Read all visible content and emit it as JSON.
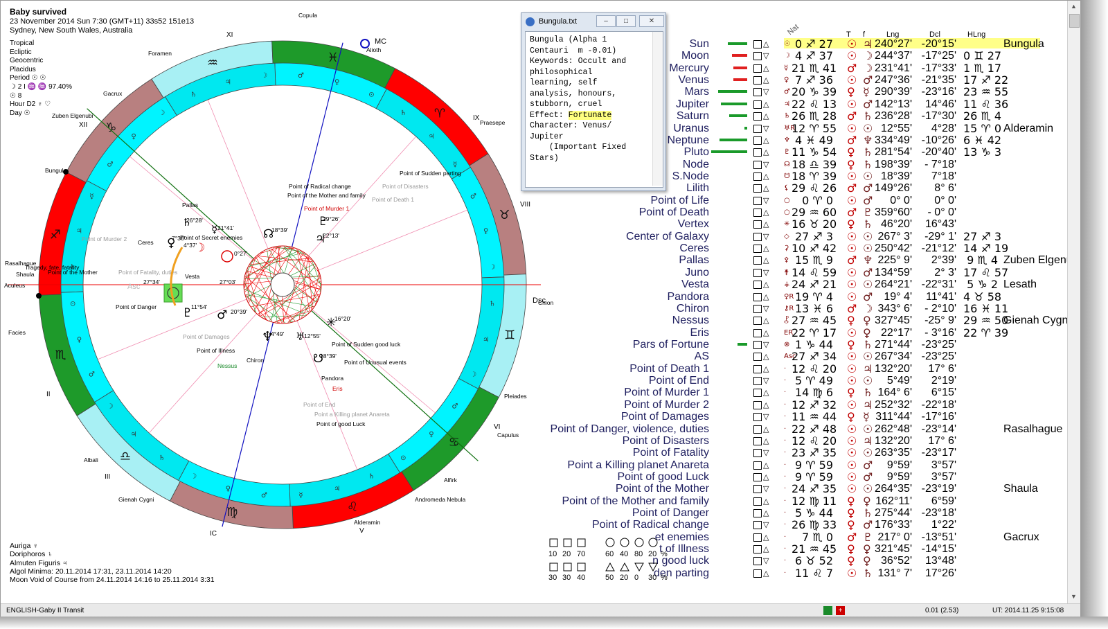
{
  "header": {
    "title": "Baby survived",
    "date_line": "23 November 2014  Sun   7:30 (GMT+11) 33s52  151e13",
    "place": "Sydney, New South Wales, Australia"
  },
  "settings": {
    "lines": [
      "Tropical",
      "Ecliptic",
      "Geocentric",
      "Placidus",
      "Period ☉ ☉",
      "☽  2 I  ♒ ♒ 97.40%",
      "☉  8",
      "Hour D2 ♀ ♡",
      "Day ☉"
    ]
  },
  "bottom_info": [
    "Auriga  ♀",
    "Doriphoros  ♄",
    "Almuten Figuris  ♃",
    "Algol Minima: 20.11.2014 17:31,  23.11.2014 14:20",
    "Moon Void of Course from 24.11.2014 14:16 to 25.11.2014  3:31"
  ],
  "status": {
    "left": "ENGLISH-Gaby  II Transit",
    "mid": "0.01 (2.53)",
    "right": "UT: 2014.11.25  9:15:08"
  },
  "popup": {
    "title": "Bungula.txt",
    "line1": "Bungula (Alpha 1\nCentauri  m -0.01)\nKeywords: Occult and\nphilosophical\nlearning, self\nanalysis, honours,\nstubborn, cruel\nEffect: ",
    "effect": "Fortunate",
    "line2": "\nCharacter: Venus/\nJupiter\n    (Important Fixed\nStars)",
    "btn_min": "–",
    "btn_max": "□",
    "btn_close": "✕"
  },
  "table_headers": {
    "nat": "Nat",
    "t": "T",
    "f": "f",
    "lng": "Lng",
    "dcl": "Dcl",
    "hlng": "HLng"
  },
  "table_rows": [
    {
      "name": "Sun",
      "sym": "☉",
      "pos": "0 ♐ 27",
      "t": "☉",
      "f": "♃",
      "lng": "240°27'",
      "dcl": "-20°15'",
      "hlng": "",
      "star": "Bungula"
    },
    {
      "name": "Moon",
      "sym": "☽",
      "pos": "4 ♐ 37",
      "t": "☉",
      "f": "☽",
      "lng": "244°37'",
      "dcl": "-17°25'",
      "hlng": "0 ♊ 27",
      "star": ""
    },
    {
      "name": "Mercury",
      "sym": "☿",
      "pos": "21 ♏ 41",
      "t": "♂",
      "f": "☽",
      "lng": "231°41'",
      "dcl": "-17°33'",
      "hlng": "1 ♏ 17",
      "star": ""
    },
    {
      "name": "Venus",
      "sym": "♀",
      "pos": "7 ♐ 36",
      "t": "☉",
      "f": "♂",
      "lng": "247°36'",
      "dcl": "-21°35'",
      "hlng": "17 ♐ 22",
      "star": ""
    },
    {
      "name": "Mars",
      "sym": "♂",
      "pos": "20 ♑ 39",
      "t": "♀",
      "f": "☿",
      "lng": "290°39'",
      "dcl": "-23°16'",
      "hlng": "23 ♒ 55",
      "star": ""
    },
    {
      "name": "Jupiter",
      "sym": "♃",
      "pos": "22 ♌ 13",
      "t": "☉",
      "f": "♂",
      "lng": "142°13'",
      "dcl": "14°46'",
      "hlng": "11 ♌ 36",
      "star": ""
    },
    {
      "name": "Saturn",
      "sym": "♄",
      "pos": "26 ♏ 28",
      "t": "♂",
      "f": "♄",
      "lng": "236°28'",
      "dcl": "-17°30'",
      "hlng": "26 ♏  4",
      "star": ""
    },
    {
      "name": "Uranus",
      "sym": "♅R",
      "pos": "12 ♈ 55",
      "t": "☉",
      "f": "☉",
      "lng": "12°55'",
      "dcl": "4°28'",
      "hlng": "15 ♈  0",
      "star": "Alderamin"
    },
    {
      "name": "Neptune",
      "sym": "♆",
      "pos": "4 ♓ 49",
      "t": "♂",
      "f": "♆",
      "lng": "334°49'",
      "dcl": "-10°26'",
      "hlng": "6 ♓ 42",
      "star": ""
    },
    {
      "name": "Pluto",
      "sym": "♇",
      "pos": "11 ♑ 54",
      "t": "♀",
      "f": "♄",
      "lng": "281°54'",
      "dcl": "-20°40'",
      "hlng": "13 ♑  3",
      "star": ""
    },
    {
      "name": "Node",
      "sym": "☊",
      "pos": "18 ♎ 39",
      "t": "♀",
      "f": "♄",
      "lng": "198°39'",
      "dcl": "- 7°18'",
      "hlng": "",
      "star": ""
    },
    {
      "name": "S.Node",
      "sym": "☋",
      "pos": "18 ♈ 39",
      "t": "☉",
      "f": "☉",
      "lng": "18°39'",
      "dcl": "7°18'",
      "hlng": "",
      "star": ""
    },
    {
      "name": "Lilith",
      "sym": "⚸",
      "pos": "29 ♌ 26",
      "t": "♂",
      "f": "♂",
      "lng": "149°26'",
      "dcl": "8° 6'",
      "hlng": "",
      "star": ""
    },
    {
      "name": "Point of Life",
      "sym": "○",
      "pos": "0 ♈  0",
      "t": "☉",
      "f": "♂",
      "lng": "0° 0'",
      "dcl": "0° 0'",
      "hlng": "",
      "star": ""
    },
    {
      "name": "Point of Death",
      "sym": "○",
      "pos": "29 ♒ 60",
      "t": "♂",
      "f": "♇",
      "lng": "359°60'",
      "dcl": "- 0° 0'",
      "hlng": "",
      "star": ""
    },
    {
      "name": "Vertex",
      "sym": "✳",
      "pos": "16 ♉ 20",
      "t": "♀",
      "f": "♄",
      "lng": "46°20'",
      "dcl": "16°43'",
      "hlng": "",
      "star": ""
    },
    {
      "name": "Center of Galaxy",
      "sym": "◇",
      "pos": "27 ♐  3",
      "t": "☉",
      "f": "☉",
      "lng": "267° 3'",
      "dcl": "-29° 1'",
      "hlng": "27 ♐  3",
      "star": ""
    },
    {
      "name": "Ceres",
      "sym": "⚳",
      "pos": "10 ♐ 42",
      "t": "☉",
      "f": "☉",
      "lng": "250°42'",
      "dcl": "-21°12'",
      "hlng": "14 ♐ 19",
      "star": ""
    },
    {
      "name": "Pallas",
      "sym": "⚴",
      "pos": "15 ♏  9",
      "t": "♂",
      "f": "♆",
      "lng": "225° 9'",
      "dcl": "2°39'",
      "hlng": "9 ♏  4",
      "star": "Zuben Elgenubi"
    },
    {
      "name": "Juno",
      "sym": "⚵",
      "pos": "14 ♌ 59",
      "t": "☉",
      "f": "♂",
      "lng": "134°59'",
      "dcl": "2° 3'",
      "hlng": "17 ♌ 57",
      "star": ""
    },
    {
      "name": "Vesta",
      "sym": "⚶",
      "pos": "24 ♐ 21",
      "t": "☉",
      "f": "☉",
      "lng": "264°21'",
      "dcl": "-22°31'",
      "hlng": "5 ♑  2",
      "star": "Lesath"
    },
    {
      "name": "Pandora",
      "sym": "♀R",
      "pos": "19 ♈  4",
      "t": "☉",
      "f": "♂",
      "lng": "19° 4'",
      "dcl": "11°41'",
      "hlng": "4 ♉ 58",
      "star": ""
    },
    {
      "name": "Chiron",
      "sym": "⚷R",
      "pos": "13 ♓  6",
      "t": "♂",
      "f": "☽",
      "lng": "343° 6'",
      "dcl": "- 2°10'",
      "hlng": "16 ♓ 11",
      "star": ""
    },
    {
      "name": "Nessus",
      "sym": "⯛",
      "pos": "27 ♒ 45",
      "t": "♀",
      "f": "♀",
      "lng": "327°45'",
      "dcl": "-25° 9'",
      "hlng": "29 ♒ 50",
      "star": "Gienah Cygni"
    },
    {
      "name": "Eris",
      "sym": "ER",
      "pos": "22 ♈ 17",
      "t": "☉",
      "f": "♀",
      "lng": "22°17'",
      "dcl": "- 3°16'",
      "hlng": "22 ♈ 39",
      "star": ""
    },
    {
      "name": "Pars of Fortune",
      "sym": "⊗",
      "pos": "1 ♑ 44",
      "t": "♀",
      "f": "♄",
      "lng": "271°44'",
      "dcl": "-23°25'",
      "hlng": "",
      "star": ""
    },
    {
      "name": "AS",
      "sym": "Asc",
      "pos": "27 ♐ 34",
      "t": "☉",
      "f": "☉",
      "lng": "267°34'",
      "dcl": "-23°25'",
      "hlng": "",
      "star": ""
    },
    {
      "name": "Point of Death 1",
      "sym": "·",
      "pos": "12 ♌ 20",
      "t": "☉",
      "f": "♃",
      "lng": "132°20'",
      "dcl": "17° 6'",
      "hlng": "",
      "star": ""
    },
    {
      "name": "Point of End",
      "sym": "·",
      "pos": "5 ♈ 49",
      "t": "☉",
      "f": "☉",
      "lng": "5°49'",
      "dcl": "2°19'",
      "hlng": "",
      "star": ""
    },
    {
      "name": "Point of Murder 1",
      "sym": "·",
      "pos": "14 ♍  6",
      "t": "♀",
      "f": "♄",
      "lng": "164° 6'",
      "dcl": "6°15'",
      "hlng": "",
      "star": ""
    },
    {
      "name": "Point of Murder 2",
      "sym": "·",
      "pos": "12 ♐ 32",
      "t": "☉",
      "f": "♃",
      "lng": "252°32'",
      "dcl": "-22°18'",
      "hlng": "",
      "star": ""
    },
    {
      "name": "Point of Damages",
      "sym": "·",
      "pos": "11 ♒ 44",
      "t": "♀",
      "f": "☿",
      "lng": "311°44'",
      "dcl": "-17°16'",
      "hlng": "",
      "star": ""
    },
    {
      "name": "Point of Danger, violence, duties",
      "sym": "·",
      "pos": "22 ♐ 48",
      "t": "☉",
      "f": "☉",
      "lng": "262°48'",
      "dcl": "-23°14'",
      "hlng": "",
      "star": "Rasalhague"
    },
    {
      "name": "Point of Disasters",
      "sym": "·",
      "pos": "12 ♌ 20",
      "t": "☉",
      "f": "♃",
      "lng": "132°20'",
      "dcl": "17° 6'",
      "hlng": "",
      "star": ""
    },
    {
      "name": "Point of Fatality",
      "sym": "·",
      "pos": "23 ♐ 35",
      "t": "☉",
      "f": "☉",
      "lng": "263°35'",
      "dcl": "-23°17'",
      "hlng": "",
      "star": ""
    },
    {
      "name": "Point a Killing planet Anareta",
      "sym": "·",
      "pos": "9 ♈ 59",
      "t": "☉",
      "f": "♂",
      "lng": "9°59'",
      "dcl": "3°57'",
      "hlng": "",
      "star": ""
    },
    {
      "name": "Point of good Luck",
      "sym": "·",
      "pos": "9 ♈ 59",
      "t": "☉",
      "f": "♂",
      "lng": "9°59'",
      "dcl": "3°57'",
      "hlng": "",
      "star": ""
    },
    {
      "name": "Point of the Mother",
      "sym": "·",
      "pos": "24 ♐ 35",
      "t": "☉",
      "f": "☉",
      "lng": "264°35'",
      "dcl": "-23°19'",
      "hlng": "",
      "star": "Shaula"
    },
    {
      "name": "Point of the Mother and family",
      "sym": "·",
      "pos": "12 ♍ 11",
      "t": "♀",
      "f": "♀",
      "lng": "162°11'",
      "dcl": "6°59'",
      "hlng": "",
      "star": ""
    },
    {
      "name": "Point of Danger",
      "sym": "·",
      "pos": "5 ♑ 44",
      "t": "♀",
      "f": "♄",
      "lng": "275°44'",
      "dcl": "-23°18'",
      "hlng": "",
      "star": ""
    },
    {
      "name": "Point of Radical change",
      "sym": "·",
      "pos": "26 ♍ 33",
      "t": "♀",
      "f": "♂",
      "lng": "176°33'",
      "dcl": "1°22'",
      "hlng": "",
      "star": ""
    },
    {
      "name": "et enemies",
      "sym": "·",
      "pos": "7 ♏  0",
      "t": "♂",
      "f": "♇",
      "lng": "217° 0'",
      "dcl": "-13°51'",
      "hlng": "",
      "star": "Gacrux"
    },
    {
      "name": "t of Illness",
      "sym": "·",
      "pos": "21 ♒ 45",
      "t": "♀",
      "f": "♀",
      "lng": "321°45'",
      "dcl": "-14°15'",
      "hlng": "",
      "star": ""
    },
    {
      "name": "n good luck",
      "sym": "·",
      "pos": "6 ♉ 52",
      "t": "♀",
      "f": "♀",
      "lng": "36°52'",
      "dcl": "13°48'",
      "hlng": "",
      "star": ""
    },
    {
      "name": "den parting",
      "sym": "·",
      "pos": "11 ♌  7",
      "t": "☉",
      "f": "♄",
      "lng": "131° 7'",
      "dcl": "17°26'",
      "hlng": "",
      "star": ""
    }
  ],
  "legend": {
    "row1": [
      "10",
      "20",
      "70",
      "60",
      "40",
      "80",
      "20",
      "%"
    ],
    "row2": [
      "30",
      "30",
      "40",
      "50",
      "20",
      "0",
      "30",
      "%"
    ]
  },
  "chart": {
    "house_labels": [
      "XI",
      "IX",
      "XII",
      "VIII",
      "II",
      "III",
      "VI",
      "V",
      "IC",
      "MC",
      "Asc",
      "Dsc"
    ],
    "outer_stars": [
      "Copula",
      "Alioth",
      "Foramen",
      "Praesepe",
      "Gacrux",
      "Zuben Elgenubi",
      "Bungula",
      "Rasalhague",
      "Shaula",
      "Aculeus",
      "Facies",
      "Chion Nebula",
      "Pleiades",
      "Capulus",
      "Albali",
      "Gienah Cygni",
      "Alfirk",
      "Andromeda Nebula",
      "Alderamin"
    ],
    "inner_labels": [
      "Point of Radical change",
      "Point of the Mother and family",
      "Point of Murder 1",
      "Point of Disasters",
      "Point of Death 1",
      "Point of Sudden parting",
      "Pallas",
      "Point of Murder 2",
      "Ceres",
      "Point of Secret enemies",
      "Point of the Mother",
      "Point of Fatality, duties",
      "Vesta",
      "Point of Danger",
      "Point of Damages",
      "Point of Illness",
      "Nessus",
      "Chiron",
      "Point of Sudden good luck",
      "Point of Unusual events",
      "Pandora",
      "Eris",
      "Point of End",
      "Point a Killing planet Anareta",
      "Point of good Luck",
      "Tragedy, fate, fatality"
    ],
    "degree_labels": [
      "26°28'",
      "21°41'",
      "18°39'",
      "29°26'",
      "22°13'",
      "7°36'",
      "4°37'",
      "0°27'",
      "27°03'",
      "27°34'",
      "11°54'",
      "20°39'",
      "4°49'",
      "12°55'",
      "16°20'",
      "18°39'"
    ]
  }
}
